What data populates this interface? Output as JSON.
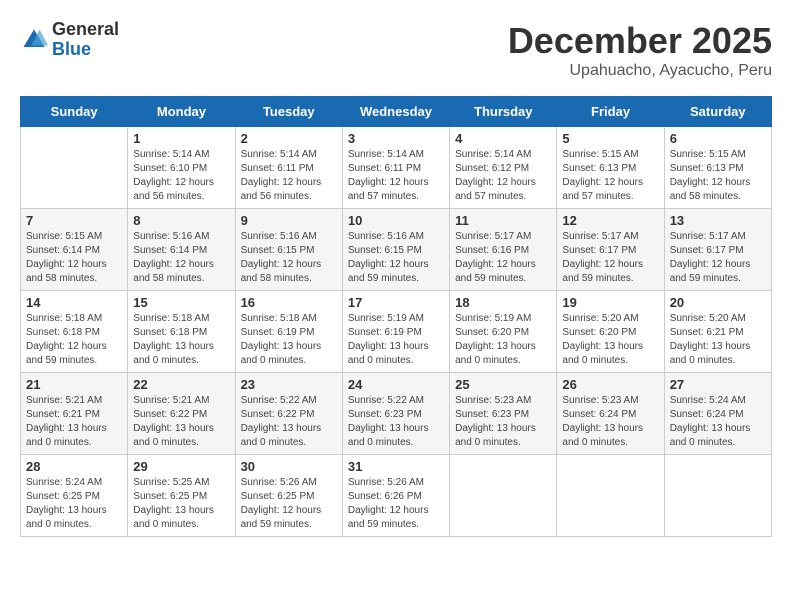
{
  "header": {
    "logo_general": "General",
    "logo_blue": "Blue",
    "month": "December 2025",
    "location": "Upahuacho, Ayacucho, Peru"
  },
  "weekdays": [
    "Sunday",
    "Monday",
    "Tuesday",
    "Wednesday",
    "Thursday",
    "Friday",
    "Saturday"
  ],
  "weeks": [
    [
      {
        "day": "",
        "info": ""
      },
      {
        "day": "1",
        "info": "Sunrise: 5:14 AM\nSunset: 6:10 PM\nDaylight: 12 hours\nand 56 minutes."
      },
      {
        "day": "2",
        "info": "Sunrise: 5:14 AM\nSunset: 6:11 PM\nDaylight: 12 hours\nand 56 minutes."
      },
      {
        "day": "3",
        "info": "Sunrise: 5:14 AM\nSunset: 6:11 PM\nDaylight: 12 hours\nand 57 minutes."
      },
      {
        "day": "4",
        "info": "Sunrise: 5:14 AM\nSunset: 6:12 PM\nDaylight: 12 hours\nand 57 minutes."
      },
      {
        "day": "5",
        "info": "Sunrise: 5:15 AM\nSunset: 6:13 PM\nDaylight: 12 hours\nand 57 minutes."
      },
      {
        "day": "6",
        "info": "Sunrise: 5:15 AM\nSunset: 6:13 PM\nDaylight: 12 hours\nand 58 minutes."
      }
    ],
    [
      {
        "day": "7",
        "info": "Sunrise: 5:15 AM\nSunset: 6:14 PM\nDaylight: 12 hours\nand 58 minutes."
      },
      {
        "day": "8",
        "info": "Sunrise: 5:16 AM\nSunset: 6:14 PM\nDaylight: 12 hours\nand 58 minutes."
      },
      {
        "day": "9",
        "info": "Sunrise: 5:16 AM\nSunset: 6:15 PM\nDaylight: 12 hours\nand 58 minutes."
      },
      {
        "day": "10",
        "info": "Sunrise: 5:16 AM\nSunset: 6:15 PM\nDaylight: 12 hours\nand 59 minutes."
      },
      {
        "day": "11",
        "info": "Sunrise: 5:17 AM\nSunset: 6:16 PM\nDaylight: 12 hours\nand 59 minutes."
      },
      {
        "day": "12",
        "info": "Sunrise: 5:17 AM\nSunset: 6:17 PM\nDaylight: 12 hours\nand 59 minutes."
      },
      {
        "day": "13",
        "info": "Sunrise: 5:17 AM\nSunset: 6:17 PM\nDaylight: 12 hours\nand 59 minutes."
      }
    ],
    [
      {
        "day": "14",
        "info": "Sunrise: 5:18 AM\nSunset: 6:18 PM\nDaylight: 12 hours\nand 59 minutes."
      },
      {
        "day": "15",
        "info": "Sunrise: 5:18 AM\nSunset: 6:18 PM\nDaylight: 13 hours\nand 0 minutes."
      },
      {
        "day": "16",
        "info": "Sunrise: 5:18 AM\nSunset: 6:19 PM\nDaylight: 13 hours\nand 0 minutes."
      },
      {
        "day": "17",
        "info": "Sunrise: 5:19 AM\nSunset: 6:19 PM\nDaylight: 13 hours\nand 0 minutes."
      },
      {
        "day": "18",
        "info": "Sunrise: 5:19 AM\nSunset: 6:20 PM\nDaylight: 13 hours\nand 0 minutes."
      },
      {
        "day": "19",
        "info": "Sunrise: 5:20 AM\nSunset: 6:20 PM\nDaylight: 13 hours\nand 0 minutes."
      },
      {
        "day": "20",
        "info": "Sunrise: 5:20 AM\nSunset: 6:21 PM\nDaylight: 13 hours\nand 0 minutes."
      }
    ],
    [
      {
        "day": "21",
        "info": "Sunrise: 5:21 AM\nSunset: 6:21 PM\nDaylight: 13 hours\nand 0 minutes."
      },
      {
        "day": "22",
        "info": "Sunrise: 5:21 AM\nSunset: 6:22 PM\nDaylight: 13 hours\nand 0 minutes."
      },
      {
        "day": "23",
        "info": "Sunrise: 5:22 AM\nSunset: 6:22 PM\nDaylight: 13 hours\nand 0 minutes."
      },
      {
        "day": "24",
        "info": "Sunrise: 5:22 AM\nSunset: 6:23 PM\nDaylight: 13 hours\nand 0 minutes."
      },
      {
        "day": "25",
        "info": "Sunrise: 5:23 AM\nSunset: 6:23 PM\nDaylight: 13 hours\nand 0 minutes."
      },
      {
        "day": "26",
        "info": "Sunrise: 5:23 AM\nSunset: 6:24 PM\nDaylight: 13 hours\nand 0 minutes."
      },
      {
        "day": "27",
        "info": "Sunrise: 5:24 AM\nSunset: 6:24 PM\nDaylight: 13 hours\nand 0 minutes."
      }
    ],
    [
      {
        "day": "28",
        "info": "Sunrise: 5:24 AM\nSunset: 6:25 PM\nDaylight: 13 hours\nand 0 minutes."
      },
      {
        "day": "29",
        "info": "Sunrise: 5:25 AM\nSunset: 6:25 PM\nDaylight: 13 hours\nand 0 minutes."
      },
      {
        "day": "30",
        "info": "Sunrise: 5:26 AM\nSunset: 6:25 PM\nDaylight: 12 hours\nand 59 minutes."
      },
      {
        "day": "31",
        "info": "Sunrise: 5:26 AM\nSunset: 6:26 PM\nDaylight: 12 hours\nand 59 minutes."
      },
      {
        "day": "",
        "info": ""
      },
      {
        "day": "",
        "info": ""
      },
      {
        "day": "",
        "info": ""
      }
    ]
  ]
}
